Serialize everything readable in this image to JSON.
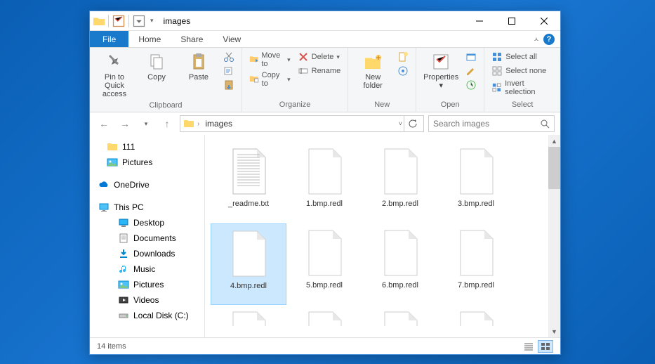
{
  "window": {
    "title": "images",
    "item_count": "14 items"
  },
  "tabs": {
    "file": "File",
    "home": "Home",
    "share": "Share",
    "view": "View"
  },
  "ribbon": {
    "clipboard": {
      "label": "Clipboard",
      "pin": "Pin to Quick access",
      "copy": "Copy",
      "paste": "Paste"
    },
    "organize": {
      "label": "Organize",
      "move": "Move to",
      "copy": "Copy to",
      "delete": "Delete",
      "rename": "Rename"
    },
    "new": {
      "label": "New",
      "new_folder": "New folder"
    },
    "open": {
      "label": "Open",
      "properties": "Properties"
    },
    "select": {
      "label": "Select",
      "all": "Select all",
      "none": "Select none",
      "invert": "Invert selection"
    }
  },
  "address": {
    "segment": "images",
    "search_placeholder": "Search images"
  },
  "nav": {
    "111": "111",
    "pictures": "Pictures",
    "onedrive": "OneDrive",
    "thispc": "This PC",
    "desktop": "Desktop",
    "documents": "Documents",
    "downloads": "Downloads",
    "music": "Music",
    "pictures2": "Pictures",
    "videos": "Videos",
    "localdisk": "Local Disk (C:)"
  },
  "files": [
    {
      "name": "_readme.txt",
      "type": "text"
    },
    {
      "name": "1.bmp.redl",
      "type": "blank"
    },
    {
      "name": "2.bmp.redl",
      "type": "blank"
    },
    {
      "name": "3.bmp.redl",
      "type": "blank"
    },
    {
      "name": "4.bmp.redl",
      "type": "blank",
      "selected": true
    },
    {
      "name": "5.bmp.redl",
      "type": "blank"
    },
    {
      "name": "6.bmp.redl",
      "type": "blank"
    },
    {
      "name": "7.bmp.redl",
      "type": "blank"
    }
  ]
}
